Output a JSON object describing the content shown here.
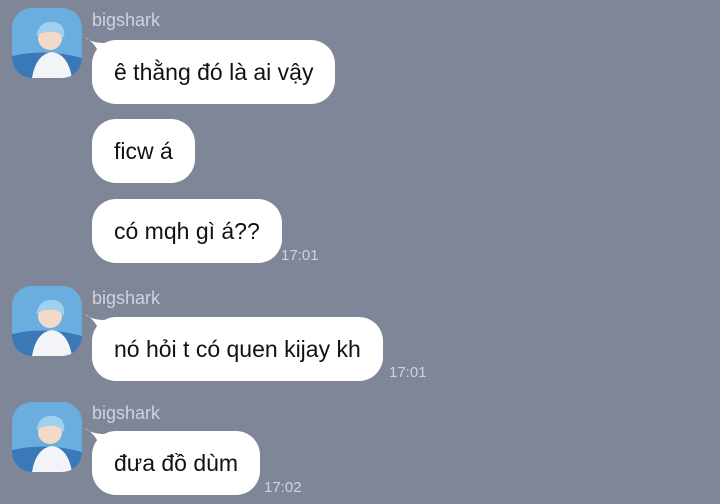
{
  "chat": {
    "background_color": "#7e8697",
    "groups": [
      {
        "sender": "bigshark",
        "avatar_icon": "profile-photo-icon",
        "messages": [
          {
            "text": "ê thằng đó là ai vậy",
            "time": ""
          },
          {
            "text": "ficw á",
            "time": ""
          },
          {
            "text": "có mqh gì á??",
            "time": "17:01"
          }
        ]
      },
      {
        "sender": "bigshark",
        "avatar_icon": "profile-photo-icon",
        "messages": [
          {
            "text": "nó hỏi t có quen kijay kh",
            "time": "17:01"
          }
        ]
      },
      {
        "sender": "bigshark",
        "avatar_icon": "profile-photo-icon",
        "messages": [
          {
            "text": "đưa đồ dùm",
            "time": "17:02"
          }
        ]
      }
    ]
  }
}
